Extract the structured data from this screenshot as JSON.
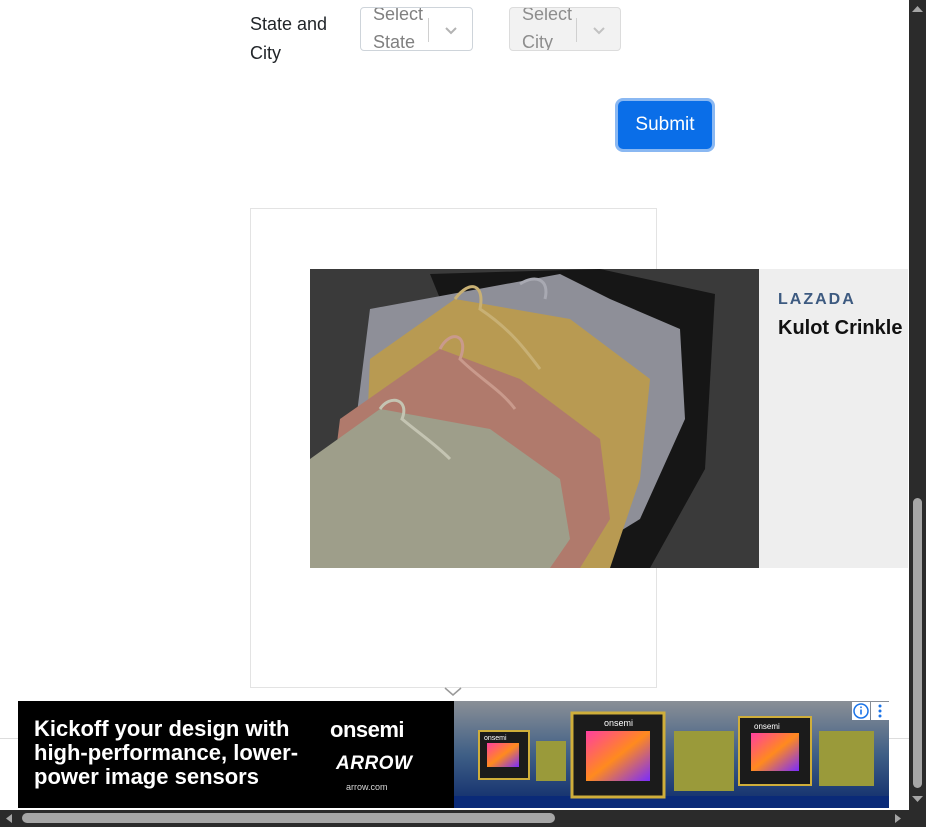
{
  "form": {
    "label": "State and City",
    "state_select": {
      "value": "Select State"
    },
    "city_select": {
      "value": "Select City"
    },
    "submit_label": "Submit"
  },
  "ad_native": {
    "brand": "LAZADA",
    "title": "Kulot Crinkle"
  },
  "ad_banner": {
    "headline": "Kickoff your design with high-performance, lower-power image sensors",
    "brand_1": "onsemi",
    "brand_2": "ARROW",
    "url": "arrow.com",
    "chip_labels": [
      "onsemi",
      "onsemi",
      "onsemi"
    ],
    "info_icon": "info-icon",
    "menu_icon": "kebab-menu-icon"
  },
  "colors": {
    "submit_bg": "#0a6ee8",
    "brand_text": "#3d5a80",
    "scrollbar": "#2b2b2b"
  }
}
